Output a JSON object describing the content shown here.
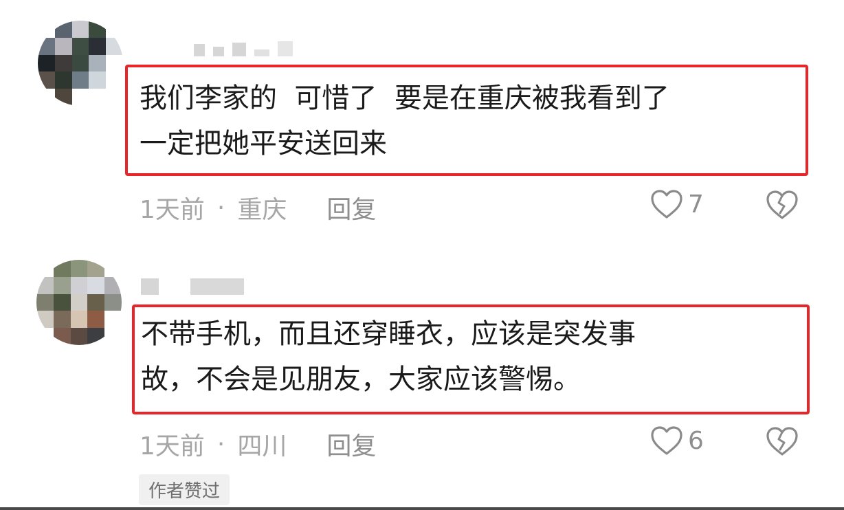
{
  "comments": [
    {
      "text": "我们李家的  可惜了  要是在重庆被我看到了\n一定把她平安送回来",
      "time": "1天前",
      "location": "重庆",
      "reply_label": "回复",
      "likes": "7",
      "avatar_colors": [
        "#ffffff",
        "#5a6470",
        "#c9c9cf",
        "#3a4a3d",
        "#ffffff",
        "#6a7480",
        "#b9b6bd",
        "#3e4e42",
        "#2b2e35",
        "#d6dbe0",
        "#1c2226",
        "#3f3b3a",
        "#3b4a40",
        "#a9b2bb",
        "#ffffff",
        "#5b514b",
        "#2e3630",
        "#6e7d88",
        "#cfd6dc",
        "#ffffff",
        "#ffffff",
        "#4f463d",
        "#ffffff",
        "#ffffff",
        "#ffffff"
      ]
    },
    {
      "text": "不带手机，而且还穿睡衣，应该是突发事\n故，不会是见朋友，大家应该警惕。",
      "time": "1天前",
      "location": "四川",
      "reply_label": "回复",
      "likes": "6",
      "author_badge": "作者赞过",
      "avatar_colors": [
        "#ffffff",
        "#6f7a5e",
        "#8b957c",
        "#a2a28f",
        "#ffffff",
        "#c2c2c0",
        "#9aa08e",
        "#cfcfd4",
        "#d9dbe3",
        "#b0b0b4",
        "#7e7f6e",
        "#49523d",
        "#d2cfc9",
        "#69604c",
        "#8b8f88",
        "#cfcbc2",
        "#7a6a5a",
        "#d7c5b3",
        "#8e5c45",
        "#ffffff",
        "#ffffff",
        "#7a5b4e",
        "#5a4a42",
        "#3c3e42",
        "#ffffff"
      ]
    }
  ]
}
